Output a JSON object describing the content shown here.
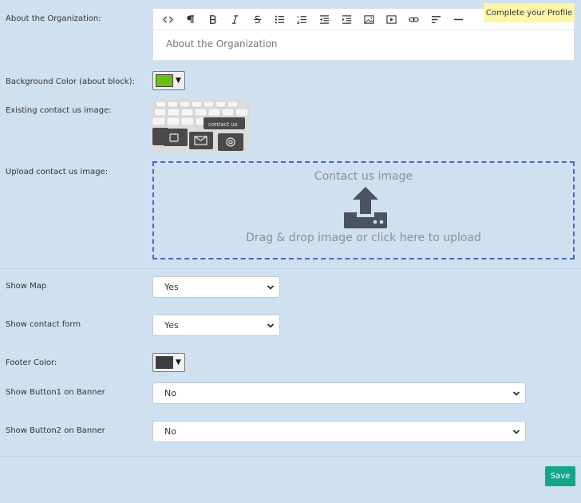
{
  "labels": {
    "about": "About the Organization:",
    "bg_color": "Background Color (about block):",
    "existing_image": "Existing contact us image:",
    "upload_image": "Upload contact us image:",
    "show_map": "Show Map",
    "show_contact_form": "Show contact form",
    "footer_color": "Footer Color:",
    "show_button1": "Show Button1 on Banner",
    "show_button2": "Show Button2 on Banner"
  },
  "editor": {
    "placeholder": "About the Organization",
    "toolbar": [
      "code-view-icon",
      "paragraph-icon",
      "bold-icon",
      "italic-icon",
      "strikethrough-icon",
      "unordered-list-icon",
      "ordered-list-icon",
      "outdent-icon",
      "indent-icon",
      "insert-image-icon",
      "insert-video-icon",
      "insert-link-icon",
      "align-left-icon",
      "horizontal-rule-icon"
    ]
  },
  "notice": {
    "complete_profile": "Complete your Profile"
  },
  "colors": {
    "bg_color_value": "#6abf1f",
    "footer_color_value": "#3d3d3d",
    "accent": "#17a589",
    "dropzone_border": "#4b63c9"
  },
  "thumb": {
    "text": "contact us"
  },
  "dropzone": {
    "title": "Contact us image",
    "hint": "Drag & drop image or click here to upload"
  },
  "fields": {
    "show_map": "Yes",
    "show_contact_form": "Yes",
    "show_button1": "No",
    "show_button2": "No"
  },
  "actions": {
    "save": "Save"
  }
}
